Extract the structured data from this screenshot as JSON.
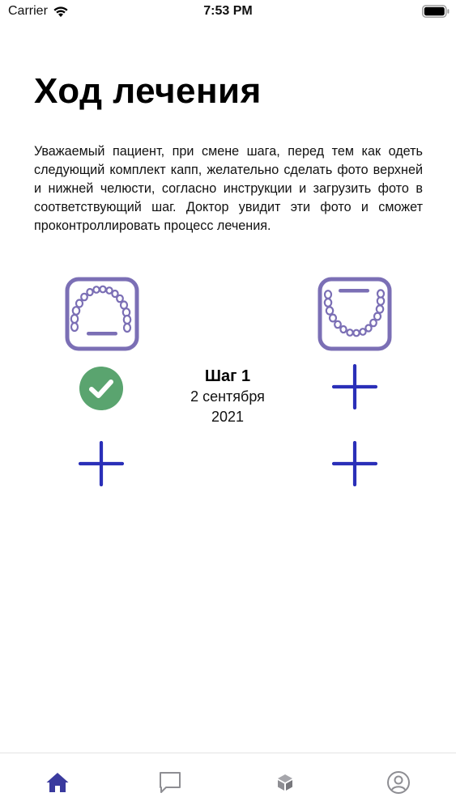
{
  "status_bar": {
    "carrier": "Carrier",
    "time": "7:53 PM"
  },
  "header": {
    "title": "Ход лечения"
  },
  "intro": {
    "text": "Уважаемый пациент, при смене шага, перед тем как одеть следующий комплект капп, желательно сделать фото верхней и нижней челюсти, согласно инструкции и загрузить фото в соответствующий шаг. Доктор увидит эти фото и сможет проконтрол­лировать процесс лечения."
  },
  "step": {
    "title": "Шаг 1",
    "date_line1": "2 сентября",
    "date_line2": "2021"
  },
  "icons": {
    "upper_jaw": "upper-jaw-icon",
    "lower_jaw": "lower-jaw-icon",
    "done": "check-circle-icon",
    "add": "plus-icon"
  },
  "colors": {
    "jaw_purple": "#7b6fb5",
    "add_blue": "#2a2fb8",
    "done_green": "#5aa46f",
    "tab_active": "#3a3a9e",
    "tab_inactive": "#8e8e93"
  },
  "tab_bar": {
    "items": [
      "home-icon",
      "chat-icon",
      "box-icon",
      "profile-icon"
    ],
    "active": "home-icon"
  }
}
